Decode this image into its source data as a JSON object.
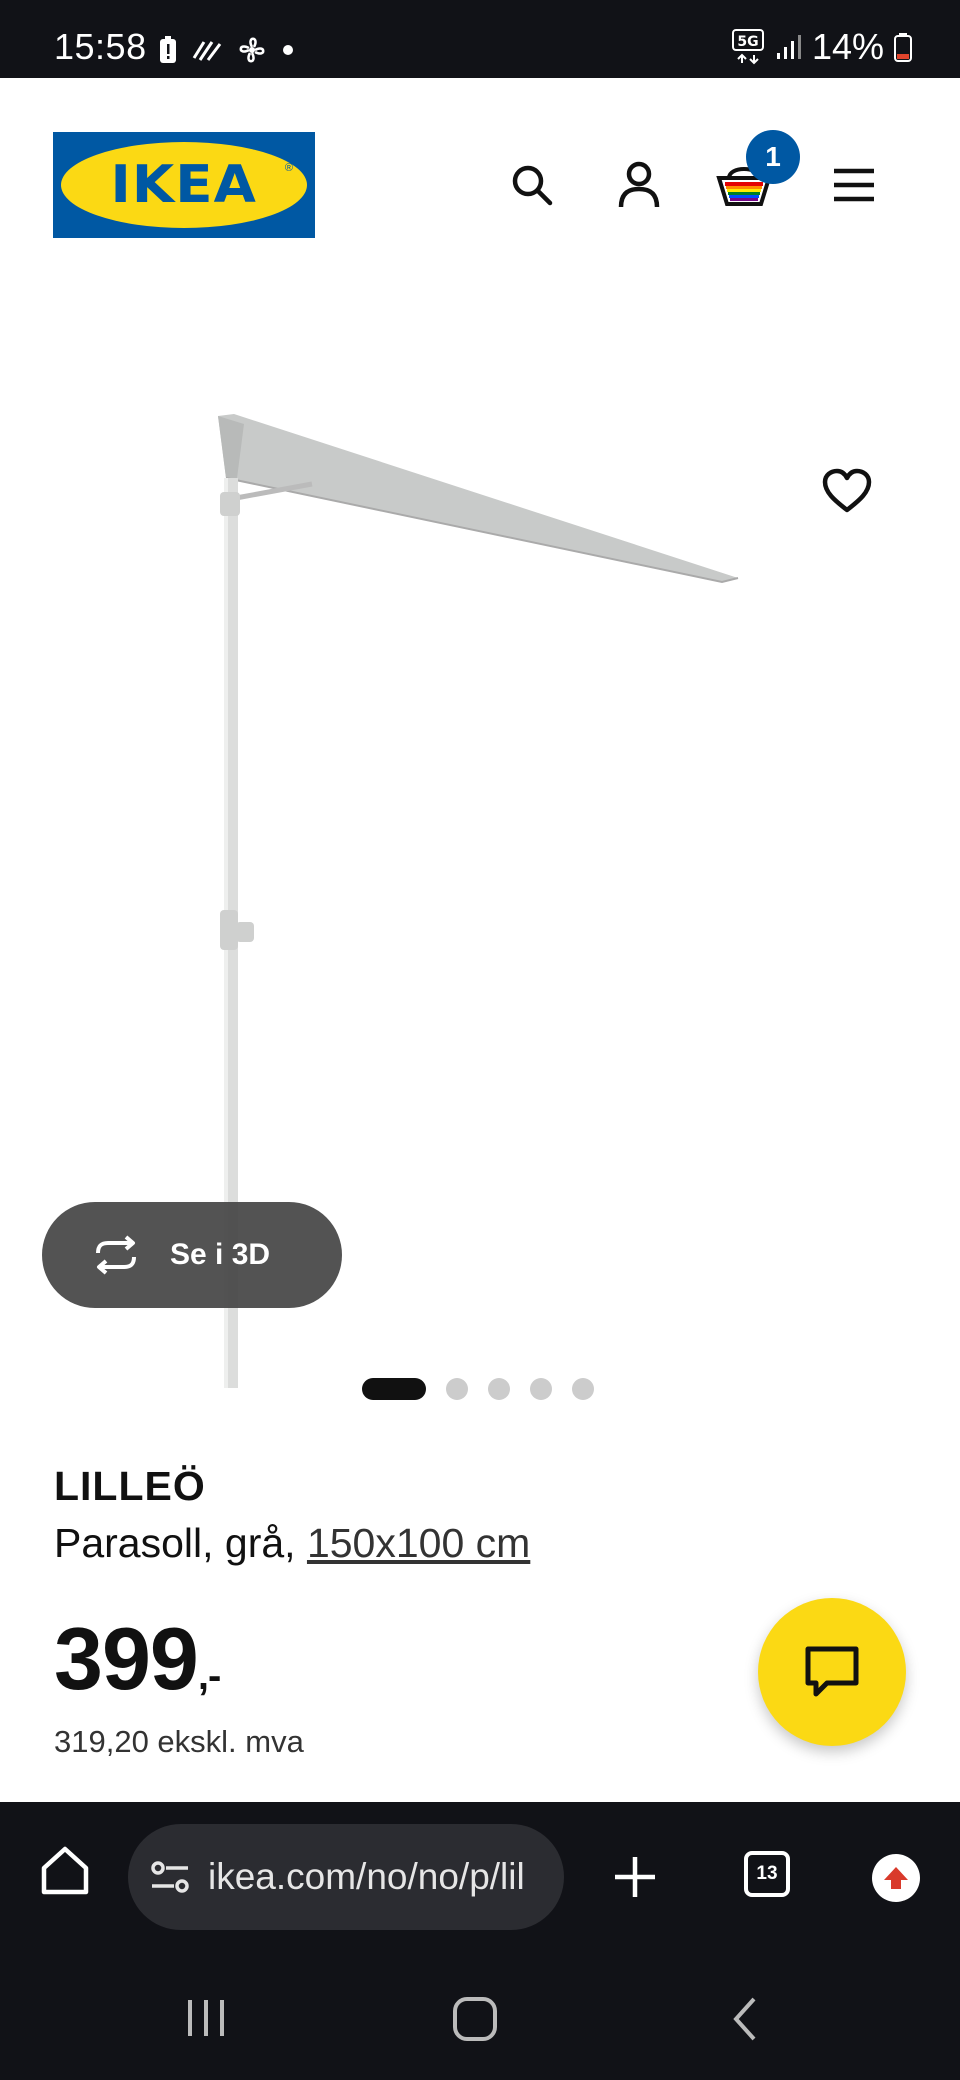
{
  "status_bar": {
    "time": "15:58",
    "network": "5G",
    "battery": "14%"
  },
  "header": {
    "logo_text": "IKEA",
    "cart_count": "1"
  },
  "gallery": {
    "view_3d_label": "Se i 3D",
    "image_count": 5,
    "active_index": 0
  },
  "product": {
    "name": "LILLEÖ",
    "description": "Parasoll, grå, ",
    "size_link": "150x100 cm",
    "price_main": "399",
    "price_suffix": ",-",
    "price_ex_vat": "319,20 ekskl. mva"
  },
  "browser": {
    "url": "ikea.com/no/no/p/lil",
    "tab_count": "13"
  },
  "colors": {
    "ikea_blue": "#0058a3",
    "ikea_yellow": "#fbd914"
  }
}
